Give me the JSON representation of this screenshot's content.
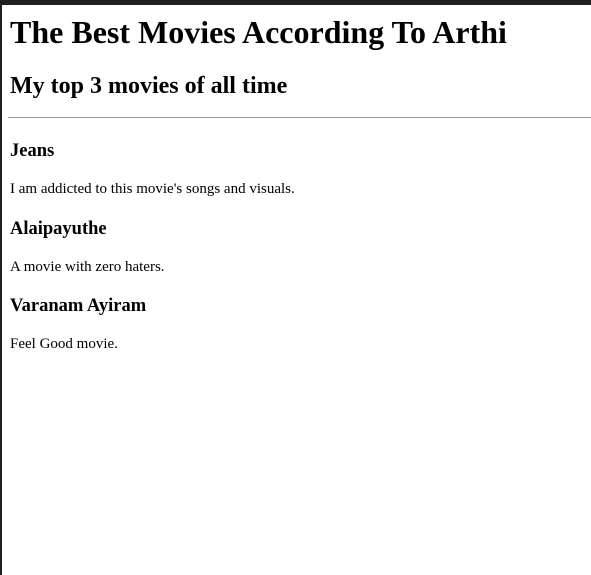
{
  "page": {
    "heading": "The Best Movies According To Arthi",
    "subheading": "My top 3 movies of all time"
  },
  "movies": [
    {
      "title": "Jeans",
      "description": "I am addicted to this movie's songs and visuals."
    },
    {
      "title": "Alaipayuthe",
      "description": "A movie with zero haters."
    },
    {
      "title": "Varanam Ayiram",
      "description": "Feel Good movie."
    }
  ],
  "colors": {
    "background": "#ffffff",
    "text": "#000000",
    "top_bar": "#1f1f1f",
    "divider": "#9a9a9a"
  }
}
